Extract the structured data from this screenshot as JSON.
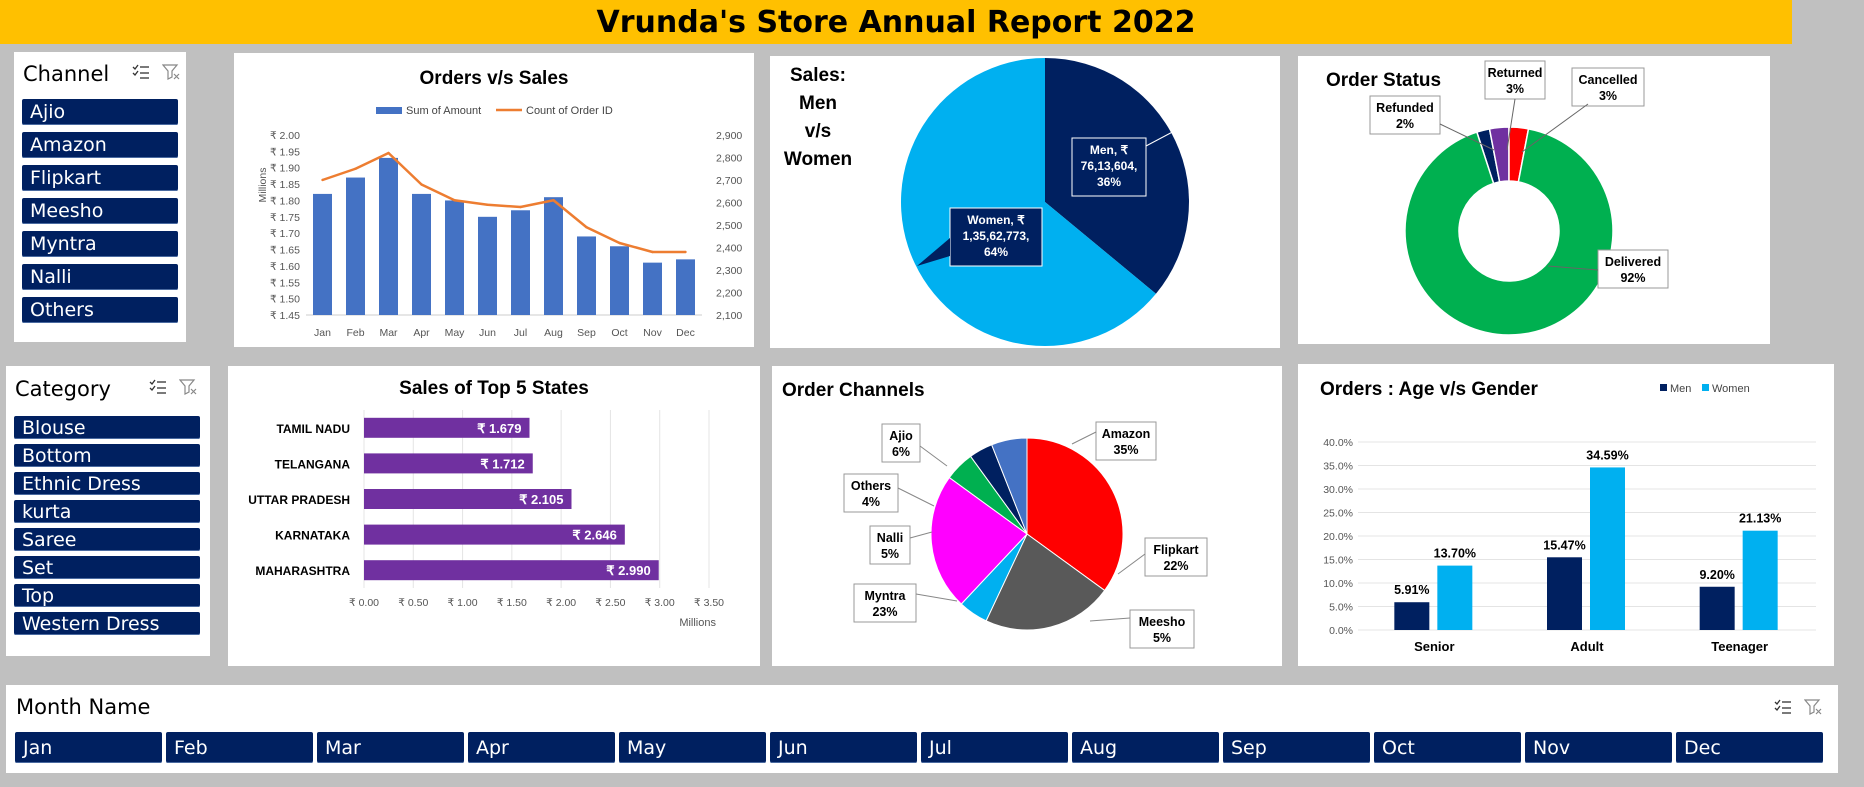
{
  "title": "Vrunda's Store Annual Report 2022",
  "colors": {
    "navy": "#002060",
    "accent": "#ffc000",
    "blue": "#4472c4",
    "orange": "#ed7d31",
    "purple": "#7030a0",
    "sky": "#00b0f0",
    "green": "#00b050",
    "red": "#ff0000",
    "magenta": "#ff00ff",
    "gray": "#595959"
  },
  "channel_slicer": {
    "title": "Channel",
    "icons": [
      "multi-select-icon",
      "clear-filter-icon"
    ],
    "items": [
      "Ajio",
      "Amazon",
      "Flipkart",
      "Meesho",
      "Myntra",
      "Nalli",
      "Others"
    ]
  },
  "category_slicer": {
    "title": "Category",
    "icons": [
      "multi-select-icon",
      "clear-filter-icon"
    ],
    "items": [
      "Blouse",
      "Bottom",
      "Ethnic Dress",
      "kurta",
      "Saree",
      "Set",
      "Top",
      "Western Dress"
    ]
  },
  "month_slicer": {
    "title": "Month Name",
    "icons": [
      "multi-select-icon",
      "clear-filter-icon"
    ],
    "items": [
      "Jan",
      "Feb",
      "Mar",
      "Apr",
      "May",
      "Jun",
      "Jul",
      "Aug",
      "Sep",
      "Oct",
      "Nov",
      "Dec"
    ]
  },
  "chart_data": [
    {
      "type": "bar",
      "title": "Orders v/s Sales",
      "categories": [
        "Jan",
        "Feb",
        "Mar",
        "Apr",
        "May",
        "Jun",
        "Jul",
        "Aug",
        "Sep",
        "Oct",
        "Nov",
        "Dec"
      ],
      "series": [
        {
          "name": "Sum of Amount",
          "kind": "bar",
          "axis": "left",
          "values": [
            1.82,
            1.87,
            1.93,
            1.82,
            1.8,
            1.75,
            1.77,
            1.81,
            1.69,
            1.66,
            1.61,
            1.62
          ]
        },
        {
          "name": "Count of Order ID",
          "kind": "line",
          "axis": "right",
          "values": [
            2700,
            2750,
            2820,
            2680,
            2610,
            2590,
            2580,
            2610,
            2490,
            2420,
            2380,
            2380
          ]
        }
      ],
      "ylabel": "Millions",
      "yticks_left": [
        "₹ 1.45",
        "₹ 1.50",
        "₹ 1.55",
        "₹ 1.60",
        "₹ 1.65",
        "₹ 1.70",
        "₹ 1.75",
        "₹ 1.80",
        "₹ 1.85",
        "₹ 1.90",
        "₹ 1.95",
        "₹ 2.00"
      ],
      "yticks_right": [
        "2,100",
        "2,200",
        "2,300",
        "2,400",
        "2,500",
        "2,600",
        "2,700",
        "2,800",
        "2,900"
      ],
      "ylim": [
        1.45,
        2.0
      ],
      "ylim_right": [
        2100,
        2900
      ],
      "legend": "top"
    },
    {
      "type": "pie",
      "title_lines": [
        "Sales:",
        "Men",
        "v/s",
        "Women"
      ],
      "slices": [
        {
          "label": "Men",
          "value": 7613604,
          "percent": 36,
          "color": "#002060",
          "text": [
            "Men, ₹",
            "76,13,604,",
            "36%"
          ]
        },
        {
          "label": "Women",
          "value": 13562773,
          "percent": 64,
          "color": "#00b0f0",
          "text": [
            "Women, ₹",
            "1,35,62,773,",
            "64%"
          ]
        }
      ]
    },
    {
      "type": "pie",
      "subtype": "doughnut",
      "title": "Order Status",
      "slices": [
        {
          "label": "Delivered",
          "percent": 92,
          "color": "#00b050"
        },
        {
          "label": "Refunded",
          "percent": 2,
          "color": "#002060"
        },
        {
          "label": "Returned",
          "percent": 3,
          "color": "#7030a0"
        },
        {
          "label": "Cancelled",
          "percent": 3,
          "color": "#ff0000"
        }
      ],
      "labels": [
        {
          "lines": [
            "Returned",
            "3%"
          ]
        },
        {
          "lines": [
            "Cancelled",
            "3%"
          ]
        },
        {
          "lines": [
            "Refunded",
            "2%"
          ]
        },
        {
          "lines": [
            "Delivered",
            "92%"
          ]
        }
      ]
    },
    {
      "type": "bar",
      "orientation": "horizontal",
      "title": "Sales of Top 5 States",
      "categories": [
        "TAMIL NADU",
        "TELANGANA",
        "UTTAR PRADESH",
        "KARNATAKA",
        "MAHARASHTRA"
      ],
      "values": [
        1.679,
        1.712,
        2.105,
        2.646,
        2.99
      ],
      "value_labels": [
        "₹ 1.679",
        "₹ 1.712",
        "₹ 2.105",
        "₹ 2.646",
        "₹ 2.990"
      ],
      "xticks": [
        "₹ 0.00",
        "₹ 0.50",
        "₹ 1.00",
        "₹ 1.50",
        "₹ 2.00",
        "₹ 2.50",
        "₹ 3.00",
        "₹ 3.50"
      ],
      "xlim": [
        0,
        3.5
      ],
      "xlabel": "Millions",
      "color": "#7030a0"
    },
    {
      "type": "pie",
      "title": "Order Channels",
      "slices": [
        {
          "label": "Amazon",
          "percent": 35,
          "color": "#ff0000"
        },
        {
          "label": "Flipkart",
          "percent": 22,
          "color": "#595959"
        },
        {
          "label": "Meesho",
          "percent": 5,
          "color": "#00b0f0"
        },
        {
          "label": "Myntra",
          "percent": 23,
          "color": "#ff00ff"
        },
        {
          "label": "Nalli",
          "percent": 5,
          "color": "#00b050"
        },
        {
          "label": "Others",
          "percent": 4,
          "color": "#002060"
        },
        {
          "label": "Ajio",
          "percent": 6,
          "color": "#4472c4"
        }
      ],
      "labels": [
        {
          "lines": [
            "Amazon",
            "35%"
          ]
        },
        {
          "lines": [
            "Flipkart",
            "22%"
          ]
        },
        {
          "lines": [
            "Meesho",
            "5%"
          ]
        },
        {
          "lines": [
            "Myntra",
            "23%"
          ]
        },
        {
          "lines": [
            "Nalli",
            "5%"
          ]
        },
        {
          "lines": [
            "Others",
            "4%"
          ]
        },
        {
          "lines": [
            "Ajio",
            "6%"
          ]
        }
      ]
    },
    {
      "type": "bar",
      "title": "Orders : Age v/s Gender",
      "categories": [
        "Senior",
        "Adult",
        "Teenager"
      ],
      "series": [
        {
          "name": "Men",
          "values": [
            5.91,
            15.47,
            9.2
          ],
          "labels": [
            "5.91%",
            "15.47%",
            "9.20%"
          ],
          "color": "#002060"
        },
        {
          "name": "Women",
          "values": [
            13.7,
            34.59,
            21.13
          ],
          "labels": [
            "13.70%",
            "34.59%",
            "21.13%"
          ],
          "color": "#00b0f0"
        }
      ],
      "yticks": [
        "0.0%",
        "5.0%",
        "10.0%",
        "15.0%",
        "20.0%",
        "25.0%",
        "30.0%",
        "35.0%",
        "40.0%"
      ],
      "ylim": [
        0,
        40
      ],
      "legend": "top-right"
    }
  ]
}
